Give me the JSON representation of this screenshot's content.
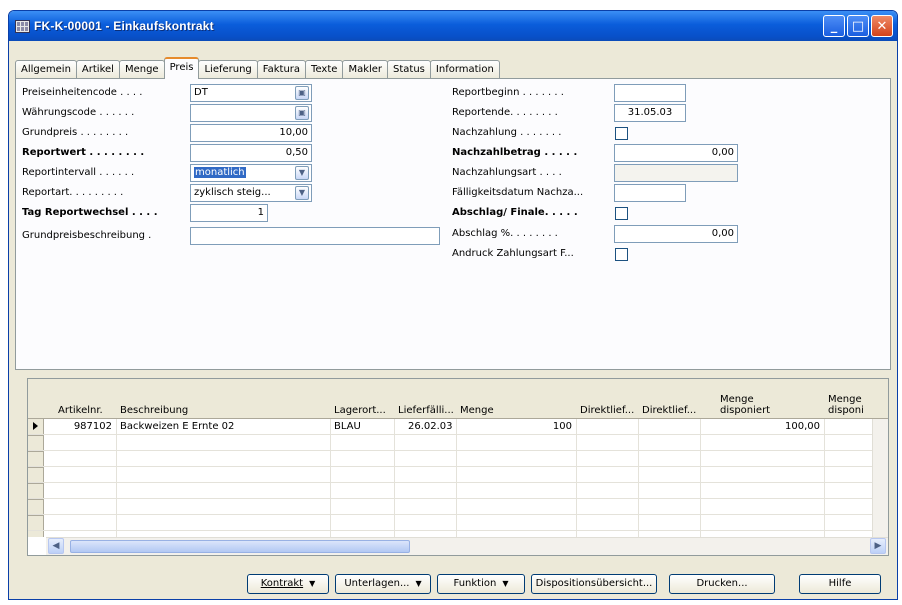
{
  "window": {
    "title": "FK-K-00001 - Einkaufskontrakt",
    "controls": {
      "minimize": "_",
      "maximize": "□",
      "close": "✕"
    }
  },
  "tabs": [
    "Allgemein",
    "Artikel",
    "Menge",
    "Preis",
    "Lieferung",
    "Faktura",
    "Texte",
    "Makler",
    "Status",
    "Information"
  ],
  "active_tab": "Preis",
  "form": {
    "left": [
      {
        "label": "Preiseinheitencode . . . .",
        "value": "DT"
      },
      {
        "label": "Währungscode . . . . . .",
        "value": ""
      },
      {
        "label": "Grundpreis . . . . . . . .",
        "value": "10,00"
      },
      {
        "label": "Reportwert . . . . . . . .",
        "value": "0,50"
      },
      {
        "label": "Reportintervall . . . . . .",
        "value": "monatlich"
      },
      {
        "label": "Reportart. . . . . . . . .",
        "value": "zyklisch steig..."
      },
      {
        "label": "Tag Reportwechsel . . . .",
        "value": "1"
      },
      {
        "label": "Grundpreisbeschreibung .",
        "value": ""
      }
    ],
    "right": [
      {
        "label": "Reportbeginn . . . . . . .",
        "value": ""
      },
      {
        "label": "Reportende. . . . . . . .",
        "value": "31.05.03"
      },
      {
        "label": "Nachzahlung . . . . . . .",
        "value": ""
      },
      {
        "label": "Nachzahlbetrag . . . . .",
        "value": "0,00"
      },
      {
        "label": "Nachzahlungsart . . . .",
        "value": ""
      },
      {
        "label": "Fälligkeitsdatum Nachza...",
        "value": ""
      },
      {
        "label": "Abschlag/ Finale. . . . .",
        "value": ""
      },
      {
        "label": "Abschlag %. . . . . . . .",
        "value": "0,00"
      },
      {
        "label": "Andruck Zahlungsart F...",
        "value": ""
      }
    ]
  },
  "grid": {
    "headers": [
      "Artikelnr.",
      "Beschreibung",
      "Lagerort...",
      "Lieferfälli...",
      "Menge",
      "Direktlief...",
      "Direktlief...",
      "Menge disponiert",
      "Menge disponi"
    ],
    "rows": [
      {
        "artikelnr": "987102",
        "beschreibung": "Backweizen E Ernte 02",
        "lagerort": "BLAU",
        "lieferfaellig": "26.02.03",
        "menge": "100",
        "direkt1": "",
        "direkt2": "",
        "disponiert": "100,00",
        "disponi": ""
      }
    ]
  },
  "buttons": {
    "kontrakt": "Kontrakt",
    "unterlagen": "Unterlagen...",
    "funktion": "Funktion",
    "dispositionsuebersicht": "Dispositionsübersicht...",
    "drucken": "Drucken...",
    "hilfe": "Hilfe"
  },
  "colors": {
    "titlebar": "#0a5ddb",
    "active_tab_accent": "#e68b2c",
    "selection": "#316ac5",
    "panel_bg": "#fcfcfe",
    "window_bg": "#ece9d8"
  }
}
